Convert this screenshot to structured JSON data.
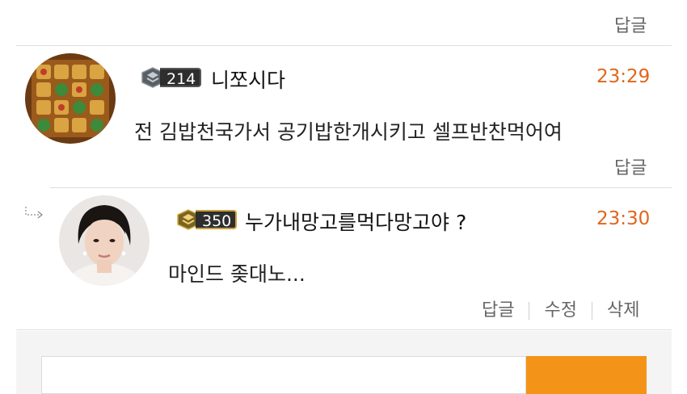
{
  "top_actions": {
    "reply_label": "답글"
  },
  "comments": [
    {
      "level": "214",
      "nickname": "니쪼시다",
      "time": "23:29",
      "text": "전 김밥천국가서 공기밥한개시키고 셀프반찬먹어여",
      "reply_label": "답글"
    },
    {
      "level": "350",
      "nickname": "누가내망고를먹다망고야 ?",
      "time": "23:30",
      "text": "마인드 좆대노...",
      "reply_label": "답글",
      "edit_label": "수정",
      "delete_label": "삭제"
    }
  ],
  "colors": {
    "accent_time": "#e0661c",
    "submit_button": "#f39418",
    "badge_gold": "#c9a23a"
  },
  "icons": {
    "reply_arrow": "reply-indent-arrow-icon",
    "level_badge": "level-shield-icon"
  }
}
